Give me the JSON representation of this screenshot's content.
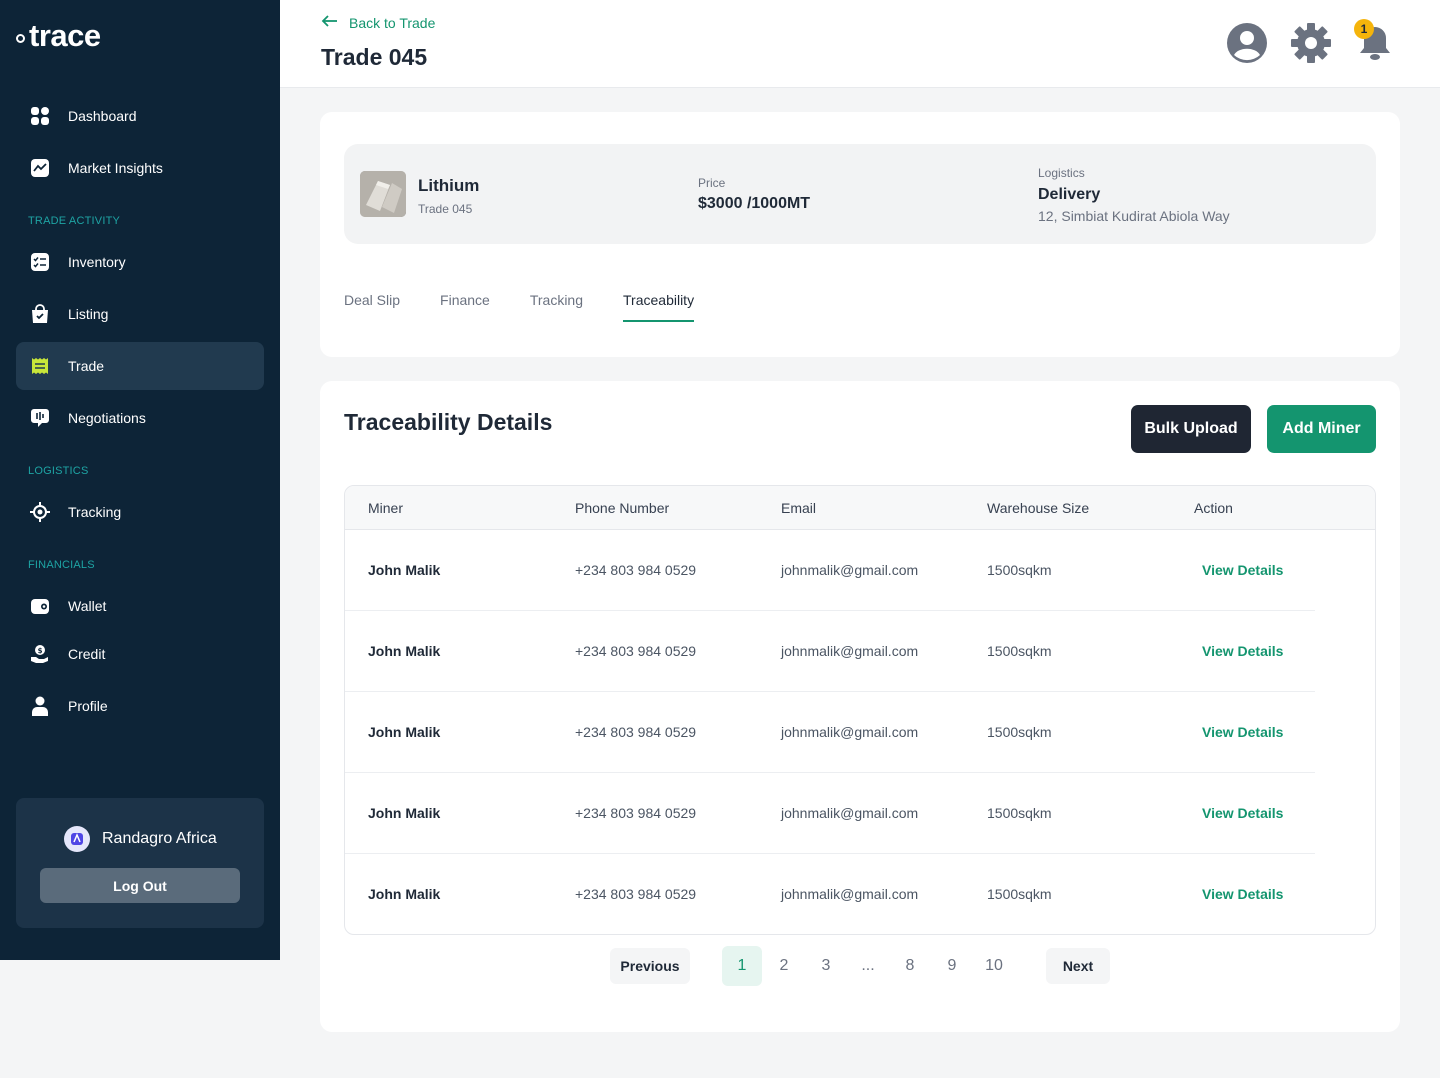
{
  "brand": {
    "name": "trace"
  },
  "sidebar": {
    "items": [
      {
        "label": "Dashboard",
        "icon": "grid-icon"
      },
      {
        "label": "Market Insights",
        "icon": "chart-icon"
      },
      {
        "label": "Inventory",
        "icon": "checklist-icon"
      },
      {
        "label": "Listing",
        "icon": "bag-check-icon"
      },
      {
        "label": "Trade",
        "icon": "receipt-icon",
        "active": true
      },
      {
        "label": "Negotiations",
        "icon": "chat-icon"
      },
      {
        "label": "Tracking",
        "icon": "location-target-icon"
      },
      {
        "label": "Wallet",
        "icon": "wallet-icon"
      },
      {
        "label": "Credit",
        "icon": "hand-coin-icon"
      },
      {
        "label": "Profile",
        "icon": "user-icon"
      }
    ],
    "sections": {
      "trade_activity": "TRADE ACTIVITY",
      "logistics": "LOGISTICS",
      "financials": "FINANCIALS"
    },
    "account": {
      "name": "Randagro Africa",
      "logout_label": "Log Out"
    }
  },
  "header": {
    "back_label": "Back to Trade",
    "title": "Trade 045",
    "notification_count": "1"
  },
  "summary": {
    "product_name": "Lithium",
    "product_sub": "Trade 045",
    "price_label": "Price",
    "price_value": "$3000 /1000MT",
    "logistics_label": "Logistics",
    "logistics_value": "Delivery",
    "logistics_address": "12, Simbiat Kudirat Abiola Way"
  },
  "tabs": [
    "Deal Slip",
    "Finance",
    "Tracking",
    "Traceability"
  ],
  "active_tab": "Traceability",
  "details": {
    "title": "Traceability Details",
    "bulk_upload_label": "Bulk Upload",
    "add_miner_label": "Add Miner",
    "columns": [
      "Miner",
      "Phone Number",
      "Email",
      "Warehouse Size",
      "Action"
    ],
    "rows": [
      {
        "miner": "John Malik",
        "phone": "+234  803 984 0529",
        "email": "johnmalik@gmail.com",
        "size": "1500sqkm",
        "action": "View Details"
      },
      {
        "miner": "John Malik",
        "phone": "+234  803 984 0529",
        "email": "johnmalik@gmail.com",
        "size": "1500sqkm",
        "action": "View Details"
      },
      {
        "miner": "John Malik",
        "phone": "+234  803 984 0529",
        "email": "johnmalik@gmail.com",
        "size": "1500sqkm",
        "action": "View Details"
      },
      {
        "miner": "John Malik",
        "phone": "+234  803 984 0529",
        "email": "johnmalik@gmail.com",
        "size": "1500sqkm",
        "action": "View Details"
      },
      {
        "miner": "John Malik",
        "phone": "+234  803 984 0529",
        "email": "johnmalik@gmail.com",
        "size": "1500sqkm",
        "action": "View Details"
      }
    ]
  },
  "pagination": {
    "previous_label": "Previous",
    "next_label": "Next",
    "pages": [
      "1",
      "2",
      "3",
      "...",
      "8",
      "9",
      "10"
    ],
    "current": "1"
  },
  "colors": {
    "sidebar_bg": "#0d2437",
    "accent_green": "#14956f",
    "section_label": "#1ea4a4",
    "badge_yellow": "#f5b40b",
    "active_icon": "#c8e63a"
  }
}
